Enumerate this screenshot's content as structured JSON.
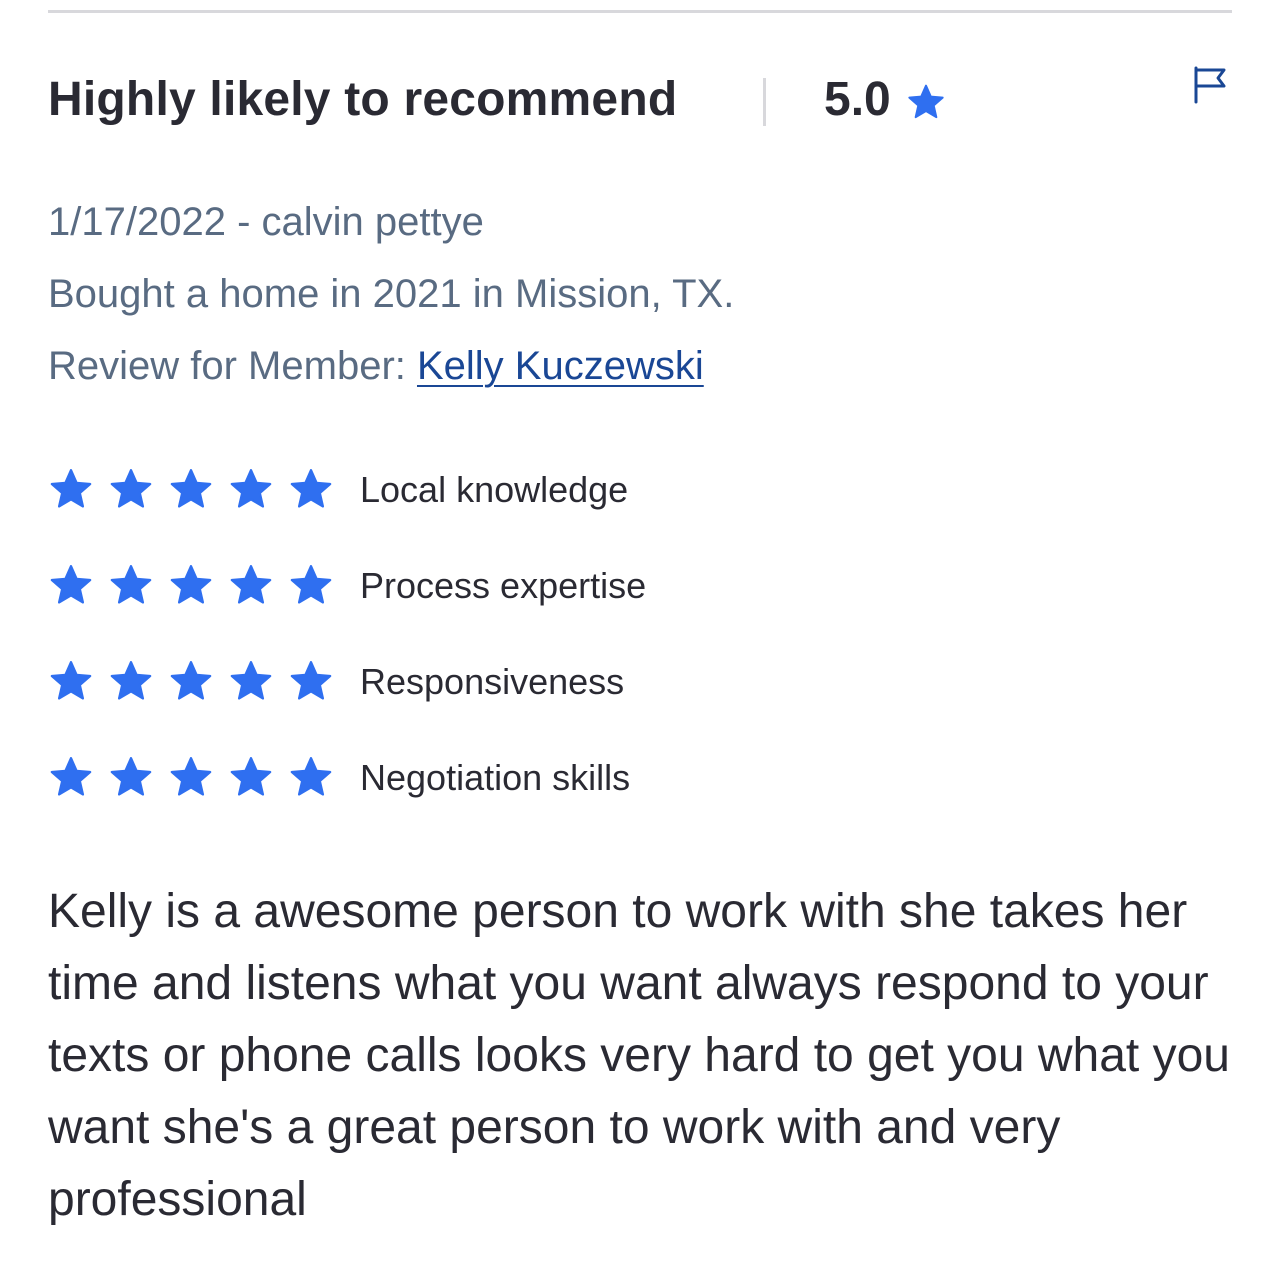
{
  "review": {
    "headline": "Highly likely to recommend",
    "score": "5.0",
    "date_author": "1/17/2022 - calvin pettye",
    "transaction": "Bought a home in 2021 in Mission, TX.",
    "member_prefix": "Review for Member: ",
    "member_name": "Kelly Kuczewski",
    "body": "Kelly is a awesome person to work with she takes her time and listens what you want always respond to your texts or phone calls looks very hard to get you what you want she's a great person to work with and very professional"
  },
  "ratings": [
    {
      "label": "Local knowledge",
      "stars": 5
    },
    {
      "label": "Process expertise",
      "stars": 5
    },
    {
      "label": "Responsiveness",
      "stars": 5
    },
    {
      "label": "Negotiation skills",
      "stars": 5
    }
  ],
  "icons": {
    "star": "star-icon",
    "flag": "flag-icon"
  },
  "colors": {
    "star": "#2f6ff0",
    "link": "#1a4795",
    "meta": "#596b82",
    "text": "#2a2a33",
    "divider": "#d8d8dc"
  }
}
